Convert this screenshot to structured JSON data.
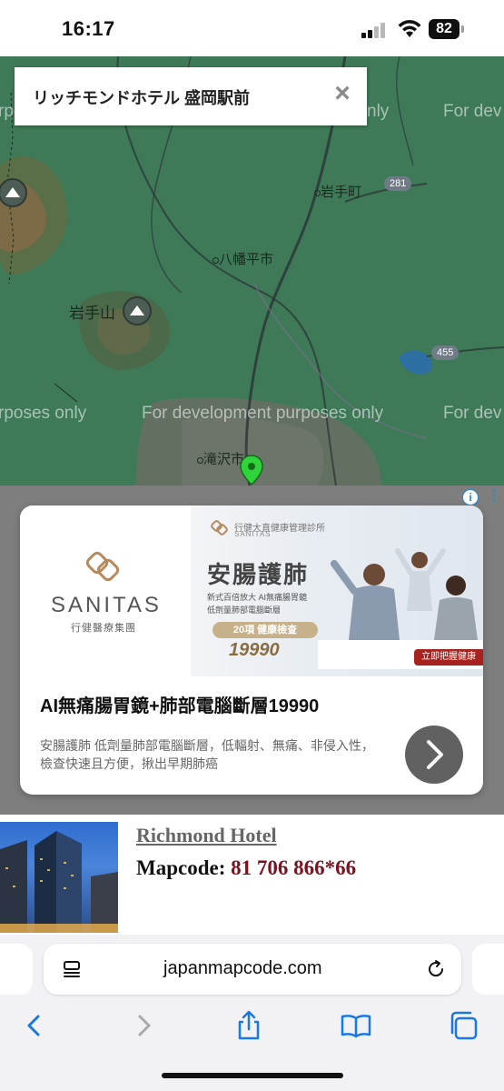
{
  "status_bar": {
    "time": "16:17",
    "battery": "82"
  },
  "map": {
    "place_card_title": "リッチモンドホテル 盛岡駅前",
    "watermark": "For development purposes only",
    "watermark_left_fragment": "rposes only",
    "watermark_right_fragment": "For dev",
    "watermark_top_fragment": "nly",
    "labels": {
      "iwate_town": "岩手町",
      "hachimantai": "八幡平市",
      "iwate_san": "岩手山",
      "takizawa": "滝沢市"
    },
    "route_shields": [
      "281",
      "455"
    ],
    "colors": {
      "land": "#3e7a57",
      "pin": "#2fd43a"
    }
  },
  "ad": {
    "brand": "SANITAS",
    "brand_sub": "行健醫療集團",
    "banner_top_line": "行健大直健康管理診所",
    "banner_top_en": "SANITAS",
    "banner_headline": "安腸護肺",
    "banner_line1": "新式百倍放大 AI無痛腸胃鏡",
    "banner_line2": "低劑量肺部電腦斷層",
    "banner_pill": "20項 健康檢查",
    "banner_price": "19990",
    "banner_cta": "立即把握健康",
    "title": "AI無痛腸胃鏡+肺部電腦斷層19990",
    "description": "安腸護肺 低劑量肺部電腦斷層，低輻射、無痛、非侵入性，檢查快速且方便，揪出早期肺癌"
  },
  "hotel": {
    "name": "Richmond Hotel",
    "mapcode_label": "Mapcode:",
    "mapcode_value": "81 706 866*66"
  },
  "browser": {
    "url": "japanmapcode.com",
    "toolbar_icons": [
      "back-icon",
      "forward-icon",
      "share-icon",
      "bookmarks-icon",
      "tabs-icon"
    ]
  }
}
